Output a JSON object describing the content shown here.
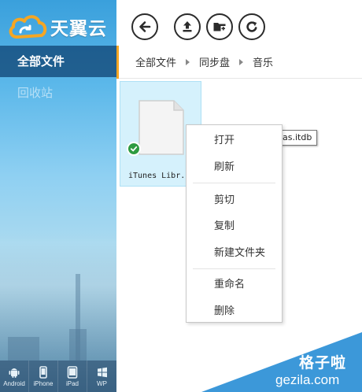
{
  "app": {
    "logo_text": "天翼云"
  },
  "sidebar": {
    "items": [
      {
        "label": "全部文件",
        "active": true
      },
      {
        "label": "回收站",
        "active": false
      }
    ],
    "devices": [
      {
        "label": "Android",
        "icon": "android-icon"
      },
      {
        "label": "iPhone",
        "icon": "iphone-icon"
      },
      {
        "label": "iPad",
        "icon": "ipad-icon"
      },
      {
        "label": "WP",
        "icon": "windows-phone-icon"
      }
    ]
  },
  "toolbar": {
    "buttons": [
      {
        "name": "back",
        "icon": "arrow-left-icon"
      },
      {
        "name": "upload",
        "icon": "upload-icon"
      },
      {
        "name": "new-folder",
        "icon": "folder-add-icon"
      },
      {
        "name": "refresh",
        "icon": "refresh-icon"
      }
    ]
  },
  "breadcrumb": [
    "全部文件",
    "同步盘",
    "音乐"
  ],
  "file": {
    "name": "iTunes Libr.",
    "tooltip": "as.itdb",
    "selected": true,
    "synced": true
  },
  "context_menu": {
    "groups": [
      [
        "打开",
        "刷新"
      ],
      [
        "剪切",
        "复制",
        "新建文件夹"
      ],
      [
        "重命名",
        "删除"
      ]
    ]
  },
  "watermark": {
    "title": "格子啦",
    "url": "gezila.com"
  },
  "colors": {
    "accent": "#f5a623",
    "nav_active": "#0c3e6e",
    "selection": "#d5f1fc",
    "sync_check": "#2e9b40",
    "watermark": "#2b8fd6"
  }
}
